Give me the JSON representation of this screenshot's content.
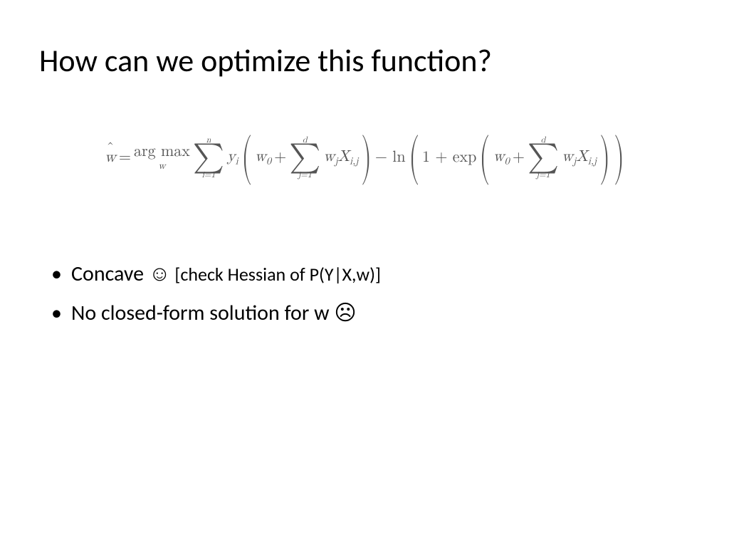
{
  "title": "How can we optimize this function?",
  "formula": {
    "lhs_var": "w",
    "eq": " = ",
    "argmax": "arg max",
    "argmax_sub": "w",
    "sum1_top": "n",
    "sum1_bot": "i=1",
    "yi": "y",
    "yi_sub": "i",
    "w0": "w",
    "w0_sub": "0",
    "plus": " + ",
    "sum2_top": "d",
    "sum2_bot": "j=1",
    "wj": "w",
    "wj_sub": "j",
    "Xij": "X",
    "Xij_sub": "i,j",
    "minus_ln": " − ln ",
    "one_plus_exp": "1 + exp "
  },
  "bullets": [
    {
      "lead": "Concave ",
      "emoji": "☺",
      "tail": " [check Hessian of P(Y|X,w)]"
    },
    {
      "lead": "No closed-form solution for w ",
      "emoji": "☹",
      "tail": ""
    }
  ]
}
